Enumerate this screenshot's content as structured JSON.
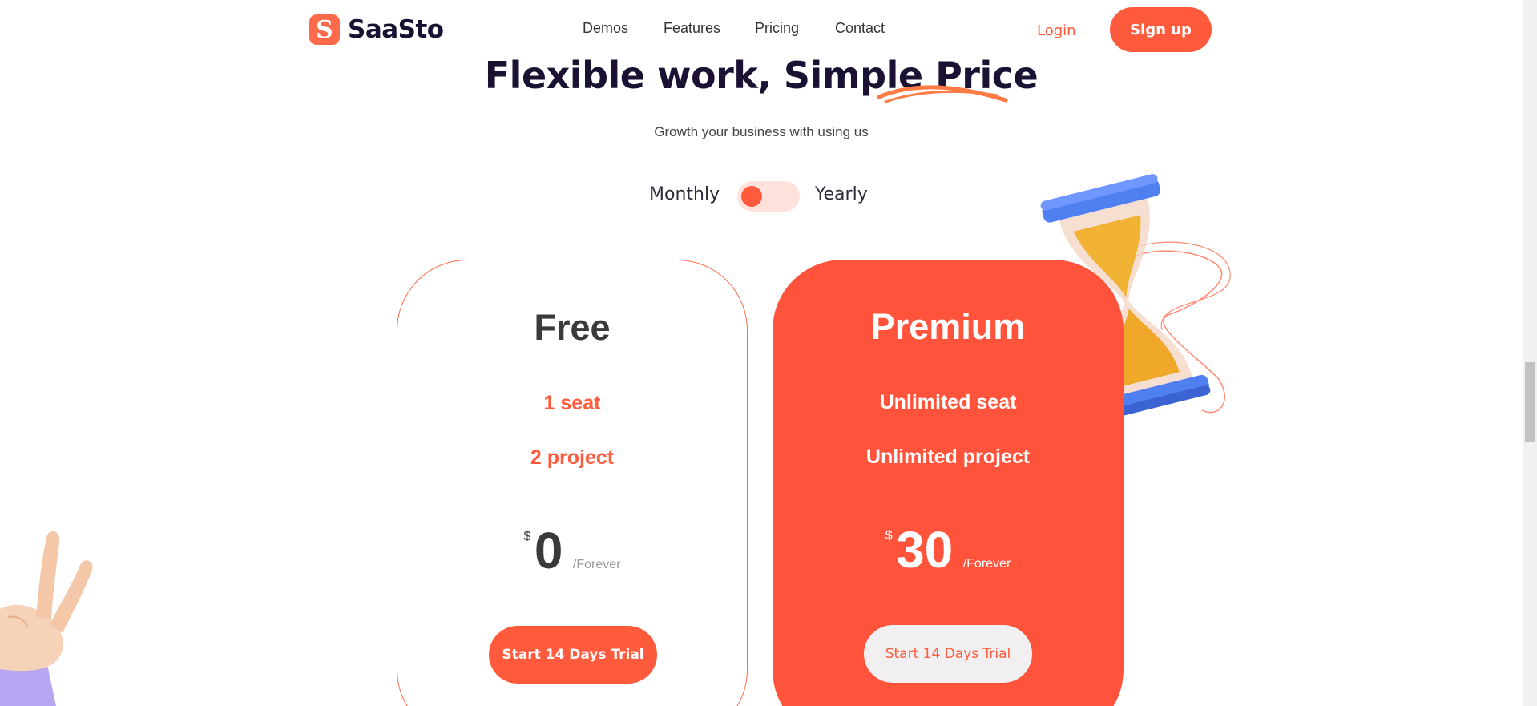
{
  "brand": {
    "logo_letter": "S",
    "name": "SaaSto",
    "accent_color": "#ff5a3c"
  },
  "nav": {
    "items": [
      "Demos",
      "Features",
      "Pricing",
      "Contact"
    ],
    "login_label": "Login",
    "signup_label": "Sign up"
  },
  "hero": {
    "headline": "Flexible work, Simple Price",
    "subtitle": "Growth your business with using us"
  },
  "billing_toggle": {
    "left_label": "Monthly",
    "right_label": "Yearly",
    "selected": "Monthly"
  },
  "plans": [
    {
      "name": "Free",
      "features": [
        "1 seat",
        "2 project"
      ],
      "currency": "$",
      "price": "0",
      "period": "/Forever",
      "cta": "Start 14 Days Trial"
    },
    {
      "name": "Premium",
      "features": [
        "Unlimited seat",
        "Unlimited project"
      ],
      "currency": "$",
      "price": "30",
      "period": "/Forever",
      "cta": "Start 14 Days Trial"
    }
  ],
  "decorations": {
    "top_right": "hourglass-illustration",
    "bottom_left": "peace-hand-illustration"
  }
}
